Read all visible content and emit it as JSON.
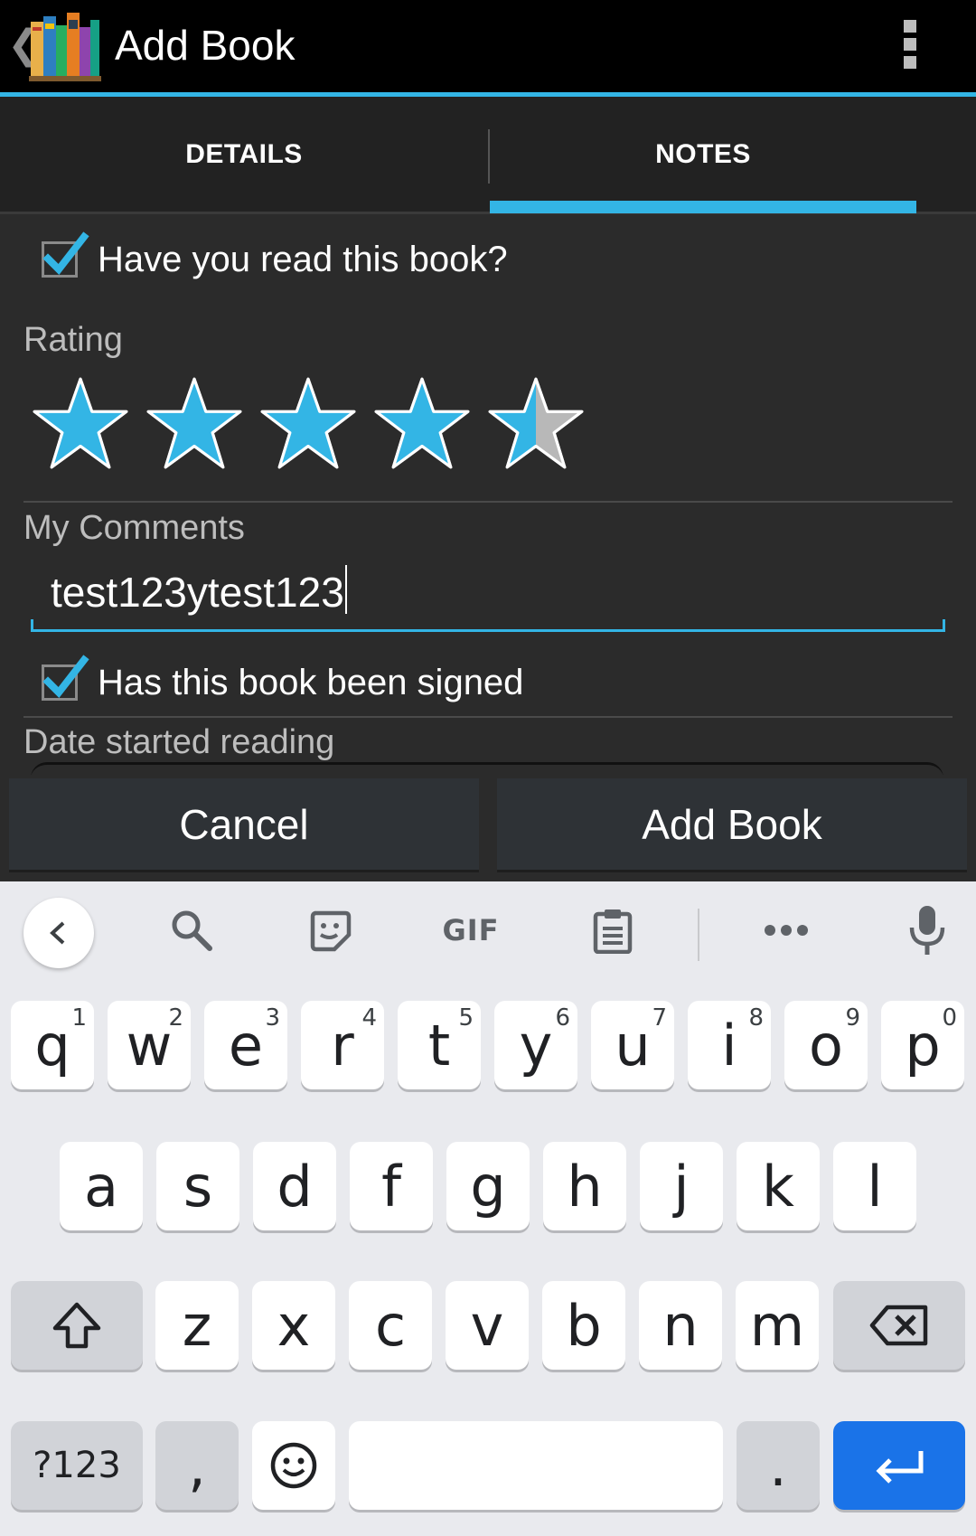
{
  "app": {
    "title": "Add Book",
    "menu_icon": "overflow-menu-icon",
    "logo_icon": "books-logo-icon",
    "accent_color": "#33b5e5"
  },
  "tabs": [
    {
      "label": "DETAILS",
      "selected": false
    },
    {
      "label": "NOTES",
      "selected": true
    }
  ],
  "notes": {
    "read_label": "Have you read this book?",
    "read_checked": true,
    "rating_label": "Rating",
    "rating_value": 4.5,
    "rating_max": 5,
    "comments_label": "My Comments",
    "comments_value": "test123ytest123",
    "signed_label": "Has this book been signed",
    "signed_checked": true,
    "date_started_label": "Date started reading"
  },
  "buttons": {
    "cancel": "Cancel",
    "add": "Add Book"
  },
  "keyboard": {
    "toolbar": [
      "back-icon",
      "search-icon",
      "sticker-icon",
      "GIF",
      "clipboard-icon",
      "more-icon",
      "mic-icon"
    ],
    "row1": [
      {
        "k": "q",
        "h": "1"
      },
      {
        "k": "w",
        "h": "2"
      },
      {
        "k": "e",
        "h": "3"
      },
      {
        "k": "r",
        "h": "4"
      },
      {
        "k": "t",
        "h": "5"
      },
      {
        "k": "y",
        "h": "6"
      },
      {
        "k": "u",
        "h": "7"
      },
      {
        "k": "i",
        "h": "8"
      },
      {
        "k": "o",
        "h": "9"
      },
      {
        "k": "p",
        "h": "0"
      }
    ],
    "row2": [
      "a",
      "s",
      "d",
      "f",
      "g",
      "h",
      "j",
      "k",
      "l"
    ],
    "row3": [
      "z",
      "x",
      "c",
      "v",
      "b",
      "n",
      "m"
    ],
    "symbols_key": "?123",
    "comma_key": ",",
    "period_key": ".",
    "enter_color": "#1a73e8"
  }
}
